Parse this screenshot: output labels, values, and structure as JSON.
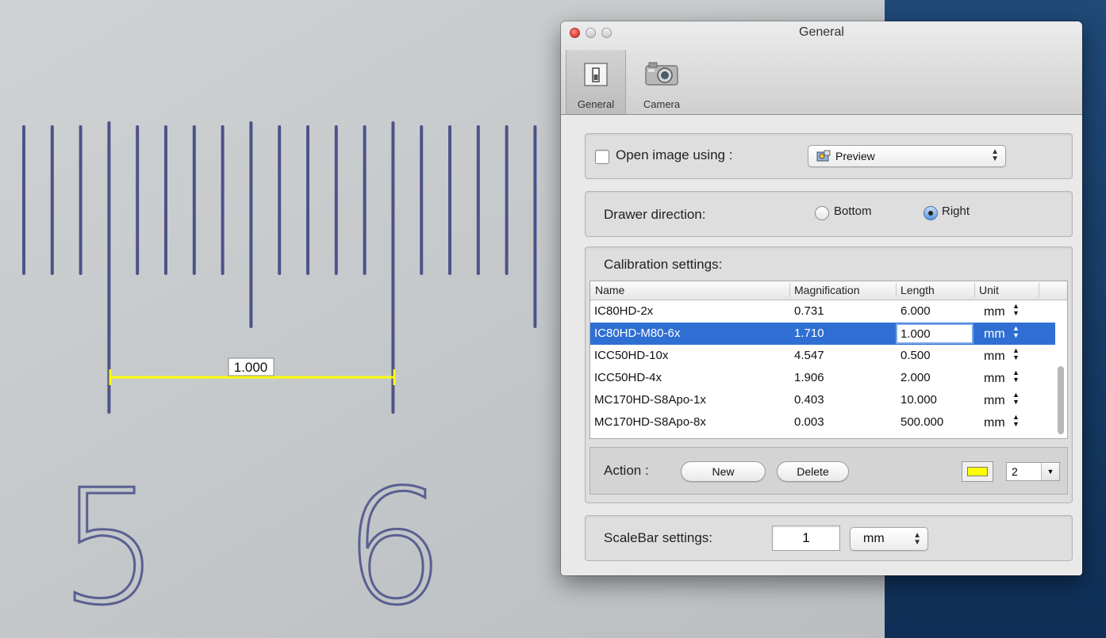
{
  "background": {
    "ruler_numbers": [
      "5",
      "6"
    ],
    "measurement_label": "1.000",
    "measurement_color": "#ffff00"
  },
  "window": {
    "title": "General",
    "toolbar": [
      {
        "label": "General",
        "icon": "switch-icon",
        "selected": true
      },
      {
        "label": "Camera",
        "icon": "camera-icon",
        "selected": false
      }
    ]
  },
  "open_image": {
    "label": "Open image using :",
    "checked": false,
    "app": "Preview"
  },
  "drawer": {
    "label": "Drawer direction:",
    "options": [
      "Bottom",
      "Right"
    ],
    "selected": "Right"
  },
  "calibration": {
    "label": "Calibration settings:",
    "columns": [
      "Name",
      "Magnification",
      "Length",
      "Unit"
    ],
    "rows": [
      {
        "name": "IC80HD-2x",
        "magnification": "0.731",
        "length": "6.000",
        "unit": "mm"
      },
      {
        "name": "IC80HD-M80-6x",
        "magnification": "1.710",
        "length": "1.000",
        "unit": "mm",
        "selected": true
      },
      {
        "name": "ICC50HD-10x",
        "magnification": "4.547",
        "length": "0.500",
        "unit": "mm"
      },
      {
        "name": "ICC50HD-4x",
        "magnification": "1.906",
        "length": "2.000",
        "unit": "mm"
      },
      {
        "name": "MC170HD-S8Apo-1x",
        "magnification": "0.403",
        "length": "10.000",
        "unit": "mm"
      },
      {
        "name": "MC170HD-S8Apo-8x",
        "magnification": "0.003",
        "length": "500.000",
        "unit": "mm"
      }
    ],
    "action_label": "Action :",
    "new_label": "New",
    "delete_label": "Delete",
    "line_color": "#ffff00",
    "line_width": "2"
  },
  "scalebar": {
    "label": "ScaleBar settings:",
    "value": "1",
    "unit": "mm"
  }
}
